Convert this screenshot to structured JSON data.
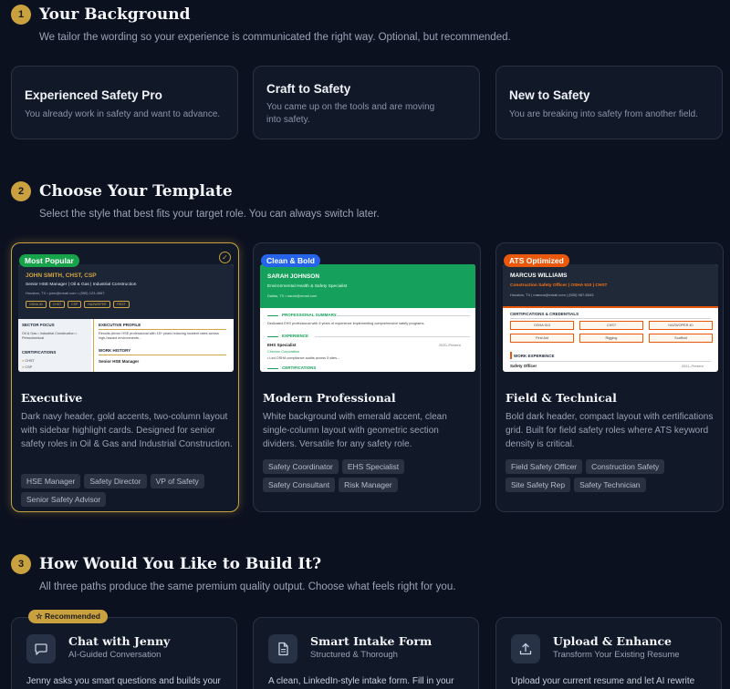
{
  "section1": {
    "num": "1",
    "title": "Your Background",
    "subtitle": "We tailor the wording so your experience is communicated the right way. Optional, but recommended.",
    "cards": [
      {
        "title": "Experienced Safety Pro",
        "desc": "You already work in safety and want to advance."
      },
      {
        "title": "Craft to Safety",
        "desc": "You came up on the tools and are moving into safety."
      },
      {
        "title": "New to Safety",
        "desc": "You are breaking into safety from another field."
      }
    ]
  },
  "section2": {
    "num": "2",
    "title": "Choose Your Template",
    "subtitle": "Select the style that best fits your target role. You can always switch later.",
    "templates": [
      {
        "badge": "Most Popular",
        "title": "Executive",
        "desc": "Dark navy header, gold accents, two-column layout with sidebar highlight cards. Designed for senior safety roles in Oil & Gas and Industrial Construction.",
        "tags": [
          "HSE Manager",
          "Safety Director",
          "VP of Safety",
          "Senior Safety Advisor"
        ],
        "preview": {
          "name": "JOHN SMITH, CHST, CSP",
          "role": "Senior HSE Manager | Oil & Gas | Industrial Construction",
          "contact": "Houston, TX  •  john@email.com  •  (555) 123-4567",
          "chips": [
            "OSHA 30",
            "CHST",
            "CSP",
            "HAZWOPER",
            "FIRST"
          ],
          "sector_focus": "SECTOR FOCUS",
          "sector_text": "Oil & Gas • Industrial Construction • Petrochemical",
          "certifications": "CERTIFICATIONS",
          "cert1": "CHST",
          "cert2": "CSP",
          "exec_profile": "EXECUTIVE PROFILE",
          "exec_text": "Results-driven HSE professional with 15+ years reducing incident rates across high-hazard environments...",
          "work_history": "WORK HISTORY",
          "job": "Senior HSE Manager"
        }
      },
      {
        "badge": "Clean & Bold",
        "title": "Modern Professional",
        "desc": "White background with emerald accent, clean single-column layout with geometric section dividers. Versatile for any safety role.",
        "tags": [
          "Safety Coordinator",
          "EHS Specialist",
          "Safety Consultant",
          "Risk Manager"
        ],
        "preview": {
          "name": "SARAH JOHNSON",
          "role": "Environmental Health & Safety Specialist",
          "contact": "Dallas, TX   •   sarah@email.com",
          "summary": "PROFESSIONAL SUMMARY",
          "summary_text": "Dedicated EHS professional with 8 years of experience implementing comprehensive safety programs.",
          "experience": "EXPERIENCE",
          "job": "EHS Specialist",
          "company": "Chevron Corporation",
          "dates": "2020–Present",
          "bullet": "• Led OSHA compliance audits across 5 sites...",
          "certs": "CERTIFICATIONS"
        }
      },
      {
        "badge": "ATS Optimized",
        "title": "Field & Technical",
        "desc": "Bold dark header, compact layout with certifications grid. Built for field safety roles where ATS keyword density is critical.",
        "tags": [
          "Field Safety Officer",
          "Construction Safety",
          "Site Safety Rep",
          "Safety Technician"
        ],
        "preview": {
          "name": "MARCUS WILLIAMS",
          "role": "Construction Safety Officer | OSHA 510 | CHST",
          "contact": "Houston, TX   |   marcus@email.com   |   (555) 987-6543",
          "certs_head": "CERTIFICATIONS & CREDENTIALS",
          "certs": [
            "OSHA 510",
            "CHST",
            "HAZWOPER 40",
            "First Aid",
            "Rigging",
            "Scaffold"
          ],
          "work": "WORK EXPERIENCE",
          "job": "Safety Officer",
          "dates": "2021–Present"
        }
      }
    ]
  },
  "section3": {
    "num": "3",
    "title": "How Would You Like to Build It?",
    "subtitle": "All three paths produce the same premium quality output. Choose what feels right for you.",
    "recommended": "☆ Recommended",
    "options": [
      {
        "title": "Chat with Jenny",
        "sub": "AI-Guided Conversation",
        "desc": "Jenny asks you smart questions and builds your",
        "icon": "chat-icon"
      },
      {
        "title": "Smart Intake Form",
        "sub": "Structured & Thorough",
        "desc": "A clean, LinkedIn-style intake form. Fill in your",
        "icon": "document-icon"
      },
      {
        "title": "Upload & Enhance",
        "sub": "Transform Your Existing Resume",
        "desc": "Upload your current resume and let AI rewrite",
        "icon": "upload-icon"
      }
    ]
  },
  "colors": {
    "gold": "#c9a13f",
    "emerald": "#16a34a",
    "orange": "#ea580c",
    "blue": "#2563eb",
    "navy": "#1b2536"
  }
}
